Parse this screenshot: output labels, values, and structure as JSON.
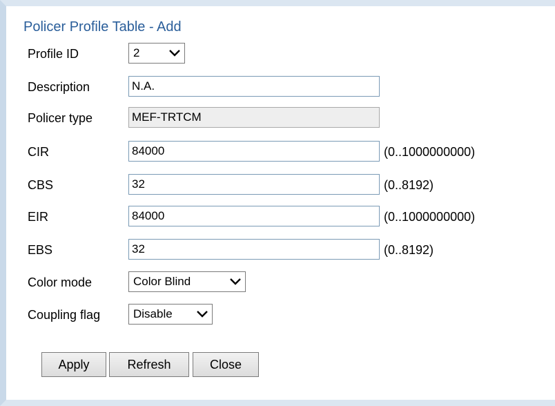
{
  "dialog": {
    "title": "Policer Profile Table - Add"
  },
  "fields": {
    "profile_id": {
      "label": "Profile ID",
      "value": "2"
    },
    "description": {
      "label": "Description",
      "value": "N.A."
    },
    "policer_type": {
      "label": "Policer type",
      "value": "MEF-TRTCM"
    },
    "cir": {
      "label": "CIR",
      "value": "84000",
      "range": "(0..1000000000)"
    },
    "cbs": {
      "label": "CBS",
      "value": "32",
      "range": "(0..8192)"
    },
    "eir": {
      "label": "EIR",
      "value": "84000",
      "range": "(0..1000000000)"
    },
    "ebs": {
      "label": "EBS",
      "value": "32",
      "range": "(0..8192)"
    },
    "color_mode": {
      "label": "Color mode",
      "value": "Color Blind"
    },
    "coupling_flag": {
      "label": "Coupling flag",
      "value": "Disable"
    }
  },
  "buttons": {
    "apply": "Apply",
    "refresh": "Refresh",
    "close": "Close"
  },
  "icons": {
    "dropdown": "chevron-down-icon"
  },
  "colors": {
    "title": "#2a5e9a",
    "field_border": "#7a9ab5",
    "disabled_field_bg": "#eeeeee",
    "frame": "#c9d9e9"
  }
}
